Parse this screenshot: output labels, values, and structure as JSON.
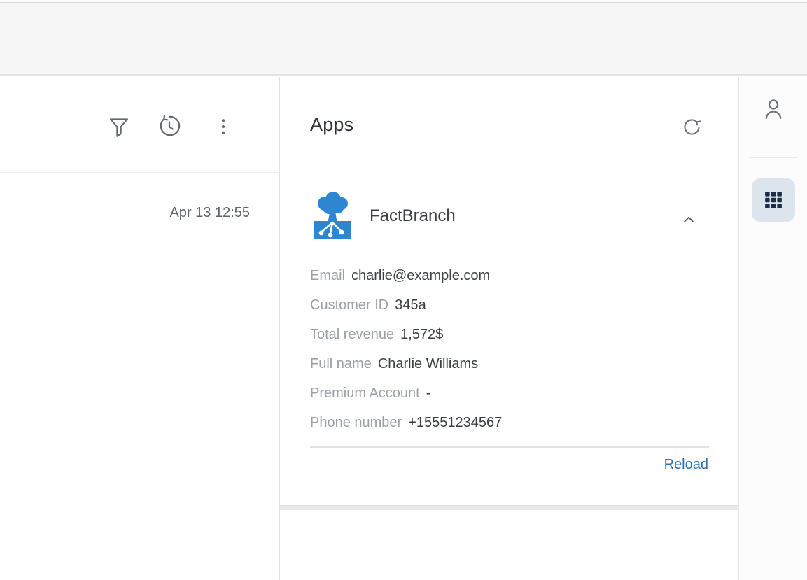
{
  "left_panel": {
    "toolbar": {
      "filter_icon": "filter-funnel-icon",
      "history_icon": "history-clock-icon",
      "more_icon": "kebab-menu-icon"
    },
    "timestamp": "Apr 13 12:55"
  },
  "apps_panel": {
    "title": "Apps",
    "refresh_icon": "refresh-icon",
    "app": {
      "name": "FactBranch",
      "logo_icon": "factbranch-tree-logo",
      "collapse_icon": "chevron-up-icon",
      "fields": [
        {
          "label": "Email",
          "value": "charlie@example.com"
        },
        {
          "label": "Customer ID",
          "value": "345a"
        },
        {
          "label": "Total revenue",
          "value": "1,572$"
        },
        {
          "label": "Full name",
          "value": "Charlie Williams"
        },
        {
          "label": "Premium Account",
          "value": "-"
        },
        {
          "label": "Phone number",
          "value": "+15551234567"
        }
      ],
      "reload_label": "Reload"
    }
  },
  "right_sidebar": {
    "profile_icon": "person-icon",
    "apps_button_icon": "grid-3x3-icon"
  },
  "colors": {
    "brand_blue": "#2e86d0",
    "link_blue": "#2c6fad",
    "label_gray": "#9aa0a6",
    "value_dark": "#3b3f44",
    "icon_gray": "#63686e",
    "apps_button_bg": "#dce4ee",
    "apps_button_fg": "#1d2b45",
    "top_band_bg": "#f7f7f8"
  }
}
